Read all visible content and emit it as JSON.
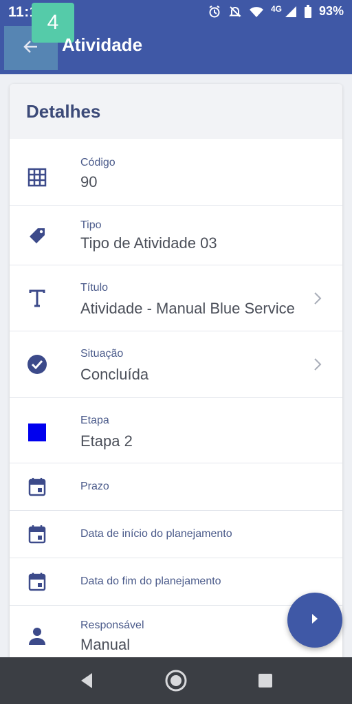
{
  "status_bar": {
    "time": "11:1",
    "network": "4G",
    "battery": "93%"
  },
  "overlay_badge": "4",
  "appbar": {
    "title": "Atividade"
  },
  "card": {
    "title": "Detalhes",
    "rows": [
      {
        "label": "Código",
        "value": "90",
        "icon": "grid-icon"
      },
      {
        "label": "Tipo",
        "value": "Tipo de Atividade 03",
        "icon": "tag-icon"
      },
      {
        "label": "Título",
        "value": "Atividade - Manual Blue Service",
        "icon": "text-icon",
        "chevron": true
      },
      {
        "label": "Situação",
        "value": "Concluída",
        "icon": "check-circle-icon",
        "chevron": true
      },
      {
        "label": "Etapa",
        "value": "Etapa 2",
        "icon": "stage-color-icon",
        "stage_color": "#0000ee"
      },
      {
        "label": "Prazo",
        "value": "",
        "icon": "calendar-icon"
      },
      {
        "label": "Data de início do planejamento",
        "value": "",
        "icon": "calendar-icon"
      },
      {
        "label": "Data do fim do planejamento",
        "value": "",
        "icon": "calendar-icon"
      },
      {
        "label": "Responsável",
        "value": "Manual",
        "icon": "person-icon"
      }
    ]
  },
  "colors": {
    "primary": "#3f58a6",
    "icon": "#3c4a8a",
    "badge": "#55cba9"
  }
}
